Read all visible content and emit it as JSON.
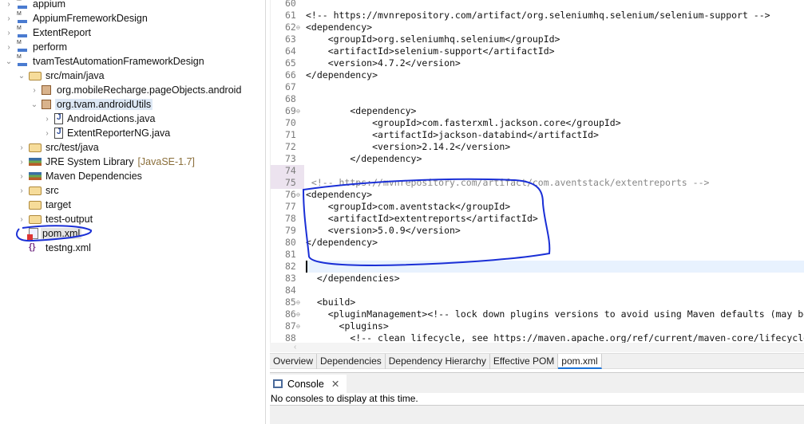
{
  "explorer": {
    "items": [
      {
        "label": "appium",
        "icon": "maven-project-icon",
        "expanded": false,
        "depth": 0
      },
      {
        "label": "AppiumFremeworkDesign",
        "icon": "maven-project-icon",
        "expanded": false,
        "depth": 0
      },
      {
        "label": "ExtentReport",
        "icon": "maven-project-icon",
        "expanded": false,
        "depth": 0
      },
      {
        "label": "perform",
        "icon": "maven-project-icon",
        "expanded": false,
        "depth": 0
      },
      {
        "label": "tvamTestAutomationFrameworkDesign",
        "icon": "maven-project-error-icon",
        "expanded": true,
        "depth": 0
      },
      {
        "label": "src/main/java",
        "icon": "source-folder-icon",
        "expanded": true,
        "depth": 1
      },
      {
        "label": "org.mobileRecharge.pageObjects.android",
        "icon": "package-icon",
        "expanded": false,
        "depth": 2
      },
      {
        "label": "org.tvam.androidUtils",
        "icon": "package-icon",
        "expanded": true,
        "depth": 2
      },
      {
        "label": "AndroidActions.java",
        "icon": "java-file-icon",
        "expanded": false,
        "depth": 3
      },
      {
        "label": "ExtentReporterNG.java",
        "icon": "java-file-icon",
        "expanded": false,
        "depth": 3
      },
      {
        "label": "src/test/java",
        "icon": "source-folder-icon",
        "expanded": false,
        "depth": 1
      },
      {
        "label": "JRE System Library",
        "suffix": "[JavaSE-1.7]",
        "icon": "library-icon",
        "expanded": false,
        "depth": 1
      },
      {
        "label": "Maven Dependencies",
        "icon": "library-icon",
        "expanded": false,
        "depth": 1
      },
      {
        "label": "src",
        "icon": "folder-icon",
        "expanded": false,
        "depth": 1
      },
      {
        "label": "target",
        "icon": "folder-icon",
        "depth": 1
      },
      {
        "label": "test-output",
        "icon": "folder-icon",
        "expanded": false,
        "depth": 1
      },
      {
        "label": "pom.xml",
        "icon": "xml-error-icon",
        "depth": 1,
        "selected": true
      },
      {
        "label": "testng.xml",
        "icon": "testng-icon",
        "depth": 1
      }
    ]
  },
  "editor": {
    "lines": [
      {
        "n": "60",
        "text": ""
      },
      {
        "n": "61",
        "text": "<!-- https://mvnrepository.com/artifact/org.seleniumhq.selenium/selenium-support -->"
      },
      {
        "n": "62",
        "text": "<dependency>",
        "fold": true
      },
      {
        "n": "63",
        "text": "    <groupId>org.seleniumhq.selenium</groupId>"
      },
      {
        "n": "64",
        "text": "    <artifactId>selenium-support</artifactId>"
      },
      {
        "n": "65",
        "text": "    <version>4.7.2</version>"
      },
      {
        "n": "66",
        "text": "</dependency>"
      },
      {
        "n": "67",
        "text": ""
      },
      {
        "n": "68",
        "text": ""
      },
      {
        "n": "69",
        "text": "        <dependency>",
        "fold": true
      },
      {
        "n": "70",
        "text": "            <groupId>com.fasterxml.jackson.core</groupId>"
      },
      {
        "n": "71",
        "text": "            <artifactId>jackson-databind</artifactId>"
      },
      {
        "n": "72",
        "text": "            <version>2.14.2</version>"
      },
      {
        "n": "73",
        "text": "        </dependency>"
      },
      {
        "n": "74",
        "text": ""
      },
      {
        "n": "75",
        "text": " <!-- https://mvnrepository.com/artifact/com.aventstack/extentreports -->",
        "comment": true
      },
      {
        "n": "76",
        "text": "<dependency>",
        "fold": true
      },
      {
        "n": "77",
        "text": "    <groupId>com.aventstack</groupId>"
      },
      {
        "n": "78",
        "text": "    <artifactId>extentreports</artifactId>"
      },
      {
        "n": "79",
        "text": "    <version>5.0.9</version>"
      },
      {
        "n": "80",
        "text": "</dependency>"
      },
      {
        "n": "81",
        "text": ""
      },
      {
        "n": "82",
        "text": "",
        "current": true
      },
      {
        "n": "83",
        "text": "  </dependencies>"
      },
      {
        "n": "84",
        "text": ""
      },
      {
        "n": "85",
        "text": "  <build>",
        "fold": true
      },
      {
        "n": "86",
        "text": "    <pluginManagement><!-- lock down plugins versions to avoid using Maven defaults (may be moved to parent pom) -->",
        "fold": true
      },
      {
        "n": "87",
        "text": "      <plugins>",
        "fold": true
      },
      {
        "n": "88",
        "text": "        <!-- clean lifecycle, see https://maven.apache.org/ref/current/maven-core/lifecycles.html"
      }
    ]
  },
  "editor_tabs": [
    "Overview",
    "Dependencies",
    "Dependency Hierarchy",
    "Effective POM",
    "pom.xml"
  ],
  "active_editor_tab": "pom.xml",
  "console": {
    "tab_label": "Console",
    "message": "No consoles to display at this time."
  },
  "colors": {
    "annotation": "#1a2fd6",
    "active_tab": "#1a73d8",
    "current_line": "#e8f2fe"
  }
}
